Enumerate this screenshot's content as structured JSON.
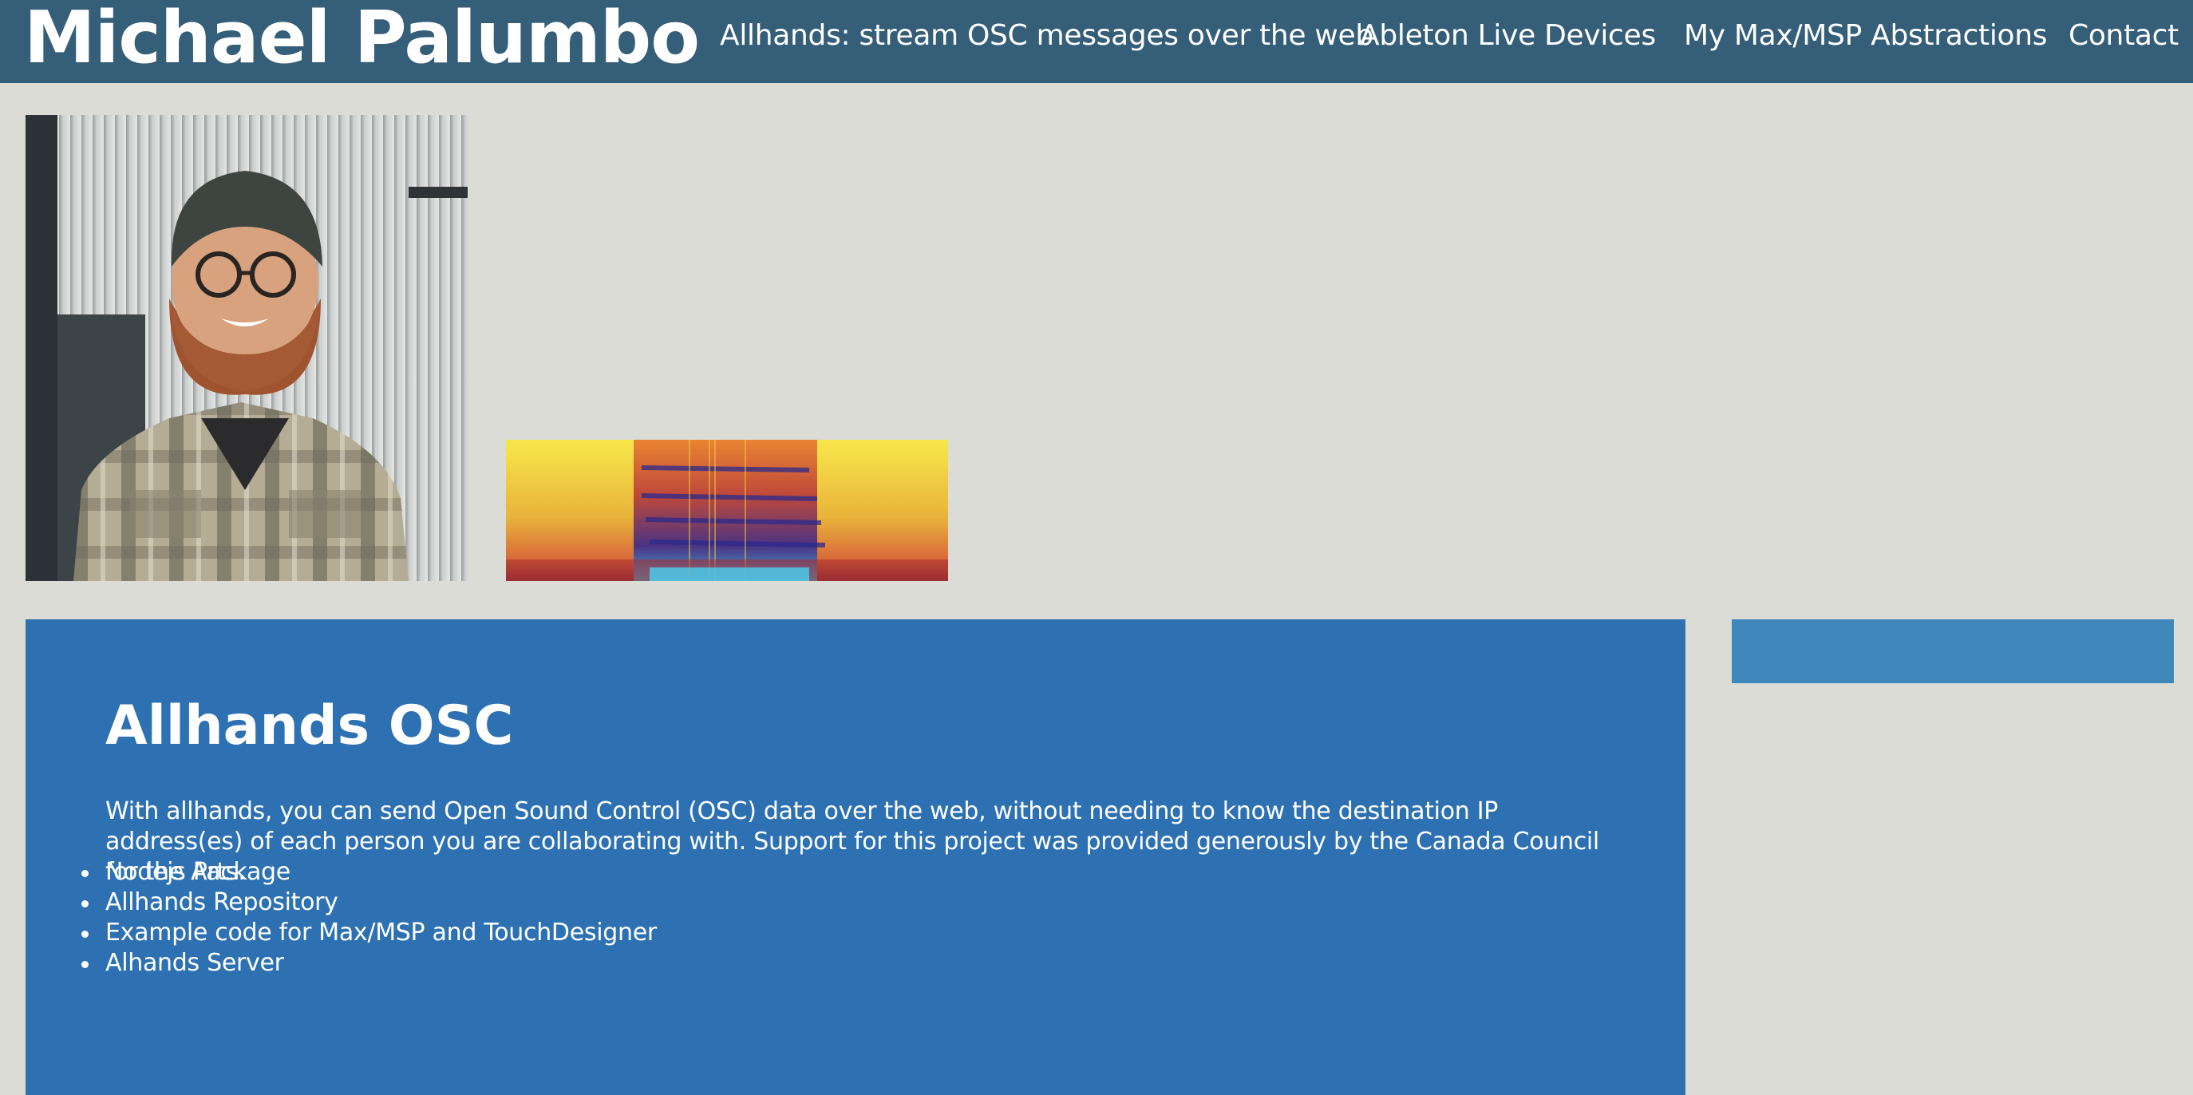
{
  "header": {
    "site_title": "Michael Palumbo",
    "nav": [
      "Allhands: stream OSC messages over the web",
      "Ableton Live Devices",
      "My Max/MSP Abstractions",
      "Contact"
    ]
  },
  "images": {
    "portrait": "portrait-photo",
    "spectrogram": "spectrogram-image"
  },
  "article": {
    "title": "Allhands OSC",
    "body": "With allhands, you can send Open Sound Control (OSC) data over the web, without needing to know the destination IP address(es) of each person you are collaborating with. Support for this project was provided generously by the Canada Council for the Arts.",
    "links": [
      "Nodejs Package",
      "Allhands Repository",
      "Example code for Max/MSP and TouchDesigner",
      "Alhands Server"
    ]
  },
  "colors": {
    "page_bg": "#dadcd5",
    "header_bg": "#355e79",
    "panel_bg": "#2d71b2",
    "side_panel_bg": "#4087bb",
    "text": "#ffffff"
  }
}
